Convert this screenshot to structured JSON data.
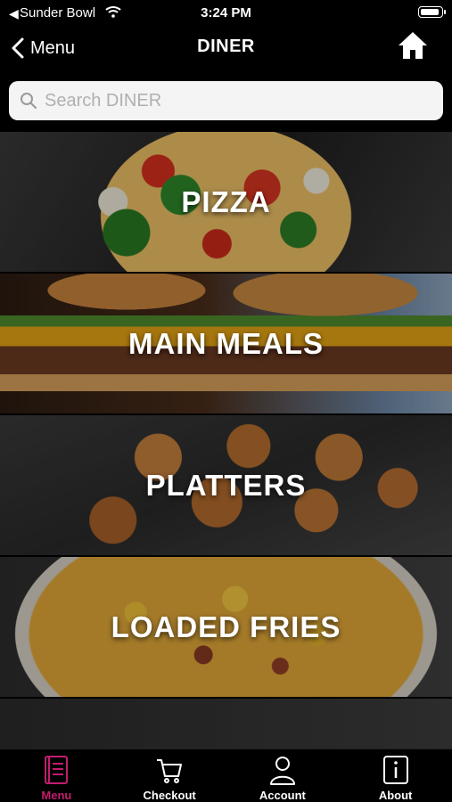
{
  "status_bar": {
    "back_arrow": "◀",
    "carrier": "Sunder Bowl",
    "time": "3:24 PM",
    "icons": [
      "wifi-icon",
      "battery-icon"
    ]
  },
  "nav": {
    "back_label": "Menu",
    "title": "DINER",
    "icons": [
      "chevron-left-icon",
      "home-icon"
    ]
  },
  "search": {
    "placeholder": "Search DINER",
    "value": "",
    "icon": "search-icon"
  },
  "categories": [
    {
      "label": "PIZZA"
    },
    {
      "label": "MAIN MEALS"
    },
    {
      "label": "PLATTERS"
    },
    {
      "label": "LOADED FRIES"
    },
    {
      "label": ""
    }
  ],
  "tabs": [
    {
      "label": "Menu",
      "icon": "menu-book-icon",
      "active": true
    },
    {
      "label": "Checkout",
      "icon": "cart-icon",
      "active": false
    },
    {
      "label": "Account",
      "icon": "user-icon",
      "active": false
    },
    {
      "label": "About",
      "icon": "info-icon",
      "active": false
    }
  ],
  "colors": {
    "background": "#000000",
    "accent": "#c21d6e",
    "search_bg": "#f4f4f4",
    "text": "#ffffff"
  }
}
